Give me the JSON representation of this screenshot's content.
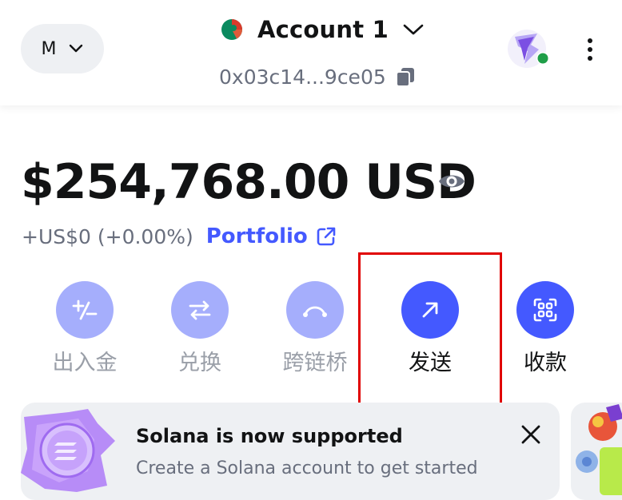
{
  "header": {
    "network_initial": "M",
    "account_name": "Account 1",
    "address_short": "0x03c14...9ce05"
  },
  "balance": {
    "amount": "$254,768.00 USD",
    "change": "+US$0 (+0.00%)",
    "portfolio_label": "Portfolio"
  },
  "actions": [
    {
      "label": "出入金",
      "icon": "buy-sell-icon",
      "style": "dim"
    },
    {
      "label": "兑换",
      "icon": "swap-icon",
      "style": "dim"
    },
    {
      "label": "跨链桥",
      "icon": "bridge-icon",
      "style": "dim"
    },
    {
      "label": "发送",
      "icon": "send-arrow-icon",
      "style": "strong"
    },
    {
      "label": "收款",
      "icon": "qr-code-icon",
      "style": "strong"
    }
  ],
  "banner": {
    "title": "Solana is now supported",
    "subtitle": "Create a Solana account to get started"
  },
  "colors": {
    "accent": "#4459ff",
    "accent_muted": "#a5aefc",
    "text_muted": "#686e7d",
    "highlight": "#e00000"
  }
}
